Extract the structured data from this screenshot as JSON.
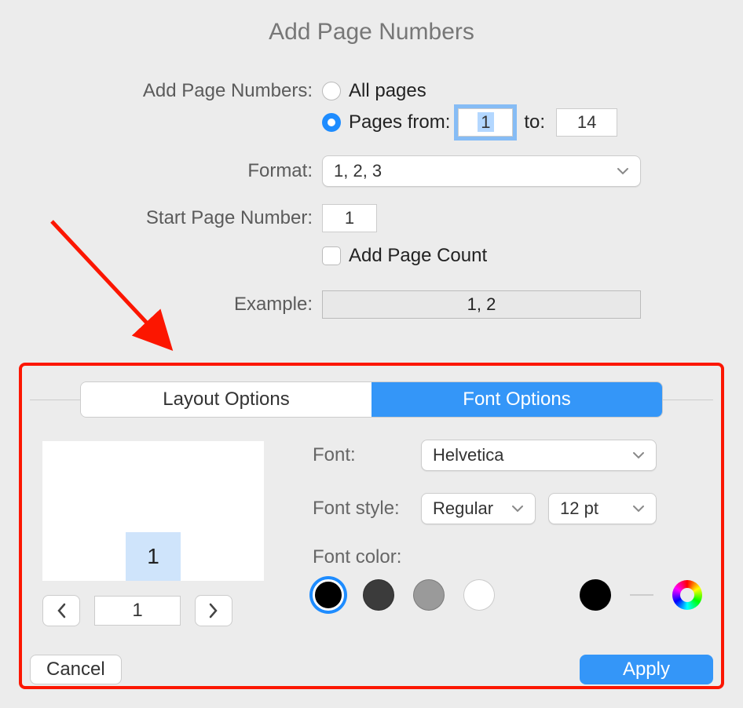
{
  "dialog": {
    "title": "Add Page Numbers"
  },
  "form": {
    "scope_label": "Add Page Numbers:",
    "all_pages_label": "All pages",
    "pages_from_label": "Pages from:",
    "pages_from_value": "1",
    "to_label": "to:",
    "pages_to_value": "14",
    "format_label": "Format:",
    "format_value": "1, 2, 3",
    "start_num_label": "Start Page Number:",
    "start_num_value": "1",
    "add_count_label": "Add Page Count",
    "example_label": "Example:",
    "example_value": "1, 2"
  },
  "tabs": {
    "layout": "Layout Options",
    "font": "Font Options"
  },
  "preview": {
    "page_number_value": "1",
    "page_field_value": "1"
  },
  "font_options": {
    "font_label": "Font:",
    "font_value": "Helvetica",
    "style_label": "Font style:",
    "style_value": "Regular",
    "size_value": "12 pt",
    "color_label": "Font color:",
    "colors": {
      "black": "#000000",
      "darkgray": "#3b3b3b",
      "gray": "#9a9a9a",
      "white": "#ffffff",
      "picked": "#000000"
    }
  },
  "buttons": {
    "cancel": "Cancel",
    "apply": "Apply"
  }
}
